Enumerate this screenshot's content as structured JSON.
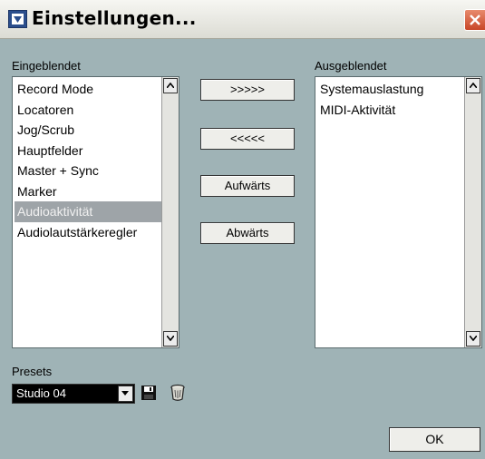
{
  "window": {
    "title": "Einstellungen...",
    "app_icon": "cubase-app-icon",
    "close_icon": "close-x-icon"
  },
  "visible_list": {
    "label": "Eingeblendet",
    "items": [
      {
        "label": "Record Mode",
        "selected": false
      },
      {
        "label": "Locatoren",
        "selected": false
      },
      {
        "label": "Jog/Scrub",
        "selected": false
      },
      {
        "label": "Hauptfelder",
        "selected": false
      },
      {
        "label": "Master + Sync",
        "selected": false
      },
      {
        "label": "Marker",
        "selected": false
      },
      {
        "label": "Audioaktivität",
        "selected": true
      },
      {
        "label": "Audiolautstärkeregler",
        "selected": false
      }
    ]
  },
  "hidden_list": {
    "label": "Ausgeblendet",
    "items": [
      {
        "label": "Systemauslastung",
        "selected": false
      },
      {
        "label": "MIDI-Aktivität",
        "selected": false
      }
    ]
  },
  "buttons": {
    "move_right": ">>>>>",
    "move_left": "<<<<<",
    "up": "Aufwärts",
    "down": "Abwärts",
    "ok": "OK"
  },
  "presets": {
    "label": "Presets",
    "value": "Studio 04",
    "save_icon": "floppy-disk-icon",
    "delete_icon": "trash-icon"
  },
  "colors": {
    "dialog_bg": "#9fb3b6",
    "selection_bg": "#9ea4a8",
    "close_button": "#d65a3a"
  }
}
